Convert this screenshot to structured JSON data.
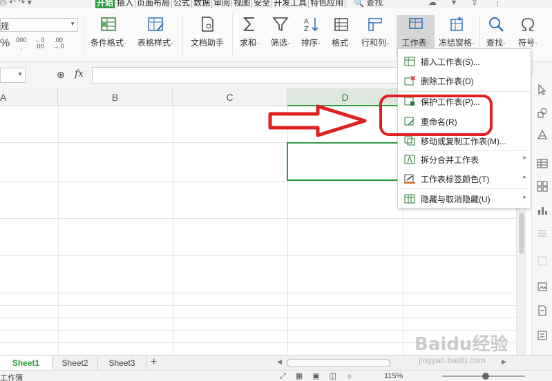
{
  "menubar": {
    "tabs": [
      "开始",
      "插入",
      "页面布局",
      "公式",
      "数据",
      "审阅",
      "视图",
      "安全",
      "开发工具",
      "特色应用"
    ],
    "search_label": "查找",
    "active_tab": "开始"
  },
  "ribbon": {
    "number_format_value": "规",
    "number_format_symbols": {
      "percent": "%",
      "thousands": "000",
      "inc_decimal": ".00",
      "dec_decimal": ".0"
    },
    "buttons": [
      {
        "id": "conditional",
        "label": "条件格式·"
      },
      {
        "id": "tablestyle",
        "label": "表格样式·"
      },
      {
        "id": "docassist",
        "label": "文档助手"
      },
      {
        "id": "sum",
        "label": "求和·"
      },
      {
        "id": "filter",
        "label": "筛选·"
      },
      {
        "id": "sort",
        "label": "排序·"
      },
      {
        "id": "format",
        "label": "格式·"
      },
      {
        "id": "rowcol",
        "label": "行和列·"
      },
      {
        "id": "worksheet",
        "label": "工作表·"
      },
      {
        "id": "freeze",
        "label": "冻结窗格·"
      },
      {
        "id": "find",
        "label": "查找·"
      },
      {
        "id": "symbol",
        "label": "符号·"
      }
    ]
  },
  "formula_bar": {
    "fx": "fx",
    "value": ""
  },
  "grid": {
    "columns": [
      "A",
      "B",
      "C",
      "D"
    ],
    "selected_column": "D"
  },
  "worksheet_menu": {
    "items": [
      {
        "label": "插入工作表(S)...",
        "submenu": false
      },
      {
        "label": "删除工作表(D)",
        "submenu": false
      },
      {
        "label": "保护工作表(P)...",
        "submenu": false
      },
      {
        "label": "重命名(R)",
        "submenu": false
      },
      {
        "label": "移动或复制工作表(M)...",
        "submenu": false
      },
      {
        "label": "拆分合并工作表",
        "submenu": true
      },
      {
        "label": "工作表标签颜色(T)",
        "submenu": true
      },
      {
        "label": "隐藏与取消隐藏(U)",
        "submenu": true
      }
    ]
  },
  "sheets": {
    "tabs": [
      "Sheet1",
      "Sheet2",
      "Sheet3"
    ],
    "active": "Sheet1",
    "add_label": "+"
  },
  "status": {
    "left_text": "工作簿",
    "zoom": "115%"
  },
  "watermark": {
    "main": "Baidu经验",
    "sub": "jingyan.baidu.com"
  },
  "colors": {
    "accent": "#2c9e3f",
    "annotation_red": "#e02020",
    "pressed_button": "#d6d6d6"
  }
}
